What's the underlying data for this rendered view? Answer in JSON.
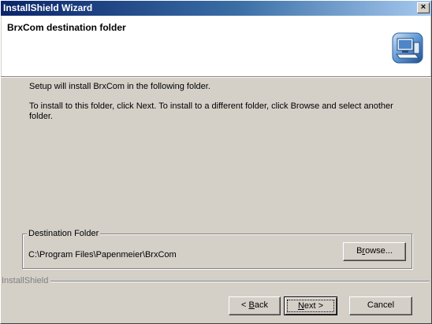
{
  "window": {
    "title": "InstallShield Wizard",
    "close_label": "×"
  },
  "header": {
    "title": "BrxCom destination folder",
    "icon": "computer-setup-icon"
  },
  "body": {
    "line1": "Setup will install BrxCom in the following folder.",
    "line2": "To install to this folder, click Next. To install to a different folder, click Browse and select another folder."
  },
  "destination": {
    "legend": "Destination Folder",
    "path": "C:\\Program Files\\Papenmeier\\BrxCom",
    "browse_pre": "B",
    "browse_ul": "r",
    "browse_post": "owse..."
  },
  "footer": {
    "brand": "InstallShield"
  },
  "buttons": {
    "back_pre": "< ",
    "back_ul": "B",
    "back_post": "ack",
    "next_ul": "N",
    "next_post": "ext >",
    "cancel": "Cancel"
  },
  "colors": {
    "title_bar_start": "#0a246a",
    "title_bar_end": "#a6caf0",
    "dialog_face": "#d4d0c8"
  }
}
